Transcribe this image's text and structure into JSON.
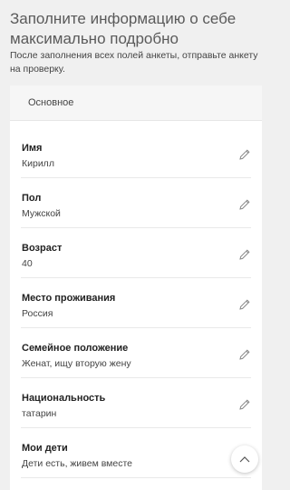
{
  "page": {
    "title": "Заполните информацию о себе максимально подробно",
    "subtitle": "После заполнения всех полей анкеты, отправьте анкету на проверку."
  },
  "section": {
    "title": "Основное"
  },
  "fields": [
    {
      "label": "Имя",
      "value": "Кирилл"
    },
    {
      "label": "Пол",
      "value": "Мужской"
    },
    {
      "label": "Возраст",
      "value": "40"
    },
    {
      "label": "Место проживания",
      "value": "Россия"
    },
    {
      "label": "Семейное положение",
      "value": "Женат, ищу вторую жену"
    },
    {
      "label": "Национальность",
      "value": "татарин"
    },
    {
      "label": "Мои дети",
      "value": "Дети есть, живем вместе"
    }
  ],
  "icons": {
    "edit": "pencil-icon",
    "scroll_top": "chevron-up-icon"
  }
}
